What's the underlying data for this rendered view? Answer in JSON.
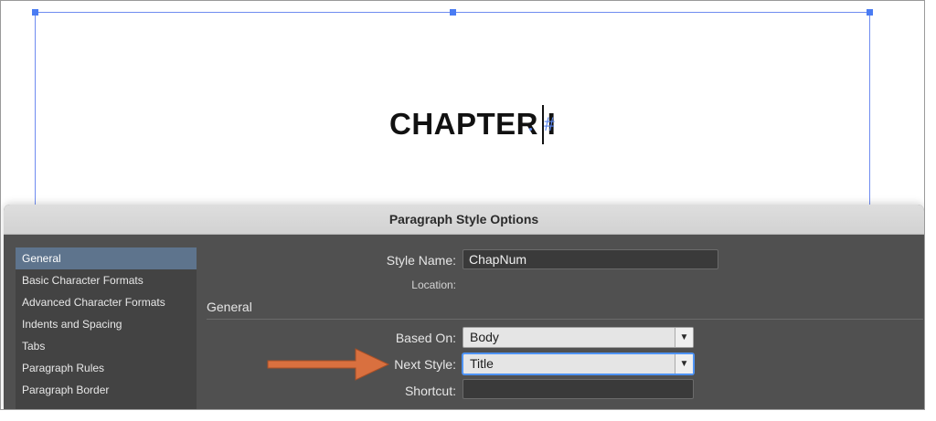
{
  "canvas": {
    "chapter_text": "CHAPTER I",
    "hash_glyph": "#"
  },
  "dialog": {
    "title": "Paragraph Style Options",
    "sidebar": {
      "items": [
        {
          "label": "General",
          "active": true
        },
        {
          "label": "Basic Character Formats",
          "active": false
        },
        {
          "label": "Advanced Character Formats",
          "active": false
        },
        {
          "label": "Indents and Spacing",
          "active": false
        },
        {
          "label": "Tabs",
          "active": false
        },
        {
          "label": "Paragraph Rules",
          "active": false
        },
        {
          "label": "Paragraph Border",
          "active": false
        }
      ]
    },
    "style_name": {
      "label": "Style Name:",
      "value": "ChapNum"
    },
    "location": {
      "label": "Location:"
    },
    "section_title": "General",
    "based_on": {
      "label": "Based On:",
      "value": "Body"
    },
    "next_style": {
      "label": "Next Style:",
      "value": "Title"
    },
    "shortcut": {
      "label": "Shortcut:",
      "value": ""
    }
  },
  "colors": {
    "arrow": "#d9703f",
    "frame_selection": "#6f8cf0",
    "sidebar_active": "#5e748d",
    "focus_ring": "#4e93f4"
  },
  "icons": {
    "chevron": "chevron-down-icon",
    "arrow": "right-arrow-icon"
  }
}
